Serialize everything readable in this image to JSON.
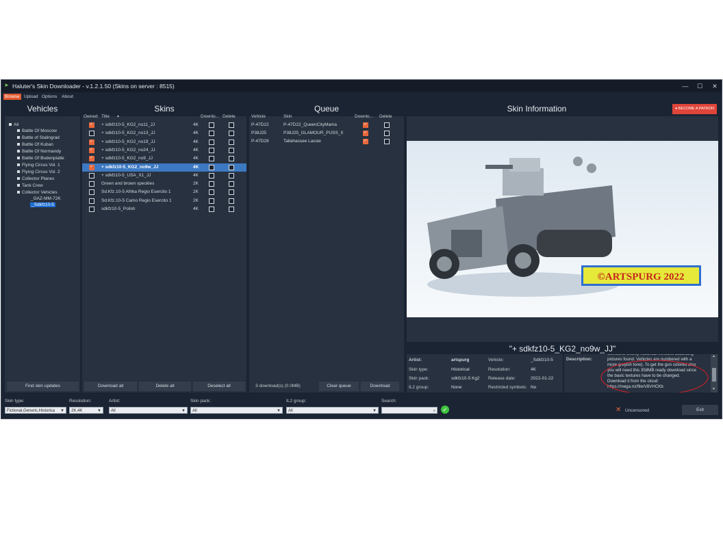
{
  "window": {
    "title": "Haluter's Skin Downloader - v.1.2.1.50 (Skins on server : 8515)",
    "controls": {
      "minimize": "—",
      "maximize": "☐",
      "close": "✕"
    }
  },
  "menu": [
    "Browse",
    "Upload",
    "Options",
    "About"
  ],
  "vehicles": {
    "title": "Vehicles",
    "root": "All",
    "groups": [
      "Battle Of Moscow",
      "Battle of Stalingrad",
      "Battle Of Kuban",
      "Battle Of Normandy",
      "Battle Of Bodenplatte",
      "Flying Circus Vol. 1",
      "Flying Circus Vol. 2",
      "Collector Planes",
      "Tank Crew",
      "Collector Vehicles"
    ],
    "children": [
      "_GAZ-MM-72K",
      "_Sdkfz10-5"
    ],
    "find_button": "Find skin updates"
  },
  "skins": {
    "title": "Skins",
    "columns": {
      "owned": "Owned",
      "title": "Title",
      "res": "Downlo...",
      "delete": "Delete"
    },
    "rows": [
      {
        "title": "+ sdkfz10-5_KG2_no11_JJ",
        "res": "4K",
        "owned": true,
        "download": false,
        "del": false,
        "sel": false
      },
      {
        "title": "+ sdkfz10-5_KG2_no13_JJ",
        "res": "4K",
        "owned": false,
        "download": false,
        "del": false,
        "sel": false
      },
      {
        "title": "+ sdkfz10-5_KG2_no19_JJ",
        "res": "4K",
        "owned": true,
        "download": false,
        "del": false,
        "sel": false
      },
      {
        "title": "+ sdkfz10-5_KG2_no24_JJ",
        "res": "4K",
        "owned": true,
        "download": false,
        "del": false,
        "sel": false
      },
      {
        "title": "+ sdkfz10-5_KG2_no9_JJ",
        "res": "4K",
        "owned": true,
        "download": false,
        "del": false,
        "sel": false
      },
      {
        "title": "+ sdkfz10-5_KG2_no9w_JJ",
        "res": "4K",
        "owned": true,
        "download": false,
        "del": false,
        "sel": true
      },
      {
        "title": "+ sdkfz10-5_USA_X1_JJ",
        "res": "4K",
        "owned": false,
        "download": false,
        "del": false,
        "sel": false
      },
      {
        "title": "Green and brown speckles",
        "res": "2K",
        "owned": false,
        "download": false,
        "del": false,
        "sel": false
      },
      {
        "title": "Sd.Kfz.10-5 Afrika Regio Esercito 1",
        "res": "2K",
        "owned": false,
        "download": false,
        "del": false,
        "sel": false
      },
      {
        "title": "Sd.Kfz.10-5 Camo Regio Esercito 1",
        "res": "2K",
        "owned": false,
        "download": false,
        "del": false,
        "sel": false
      },
      {
        "title": "sdkfz10-5_Polish",
        "res": "4K",
        "owned": false,
        "download": false,
        "del": false,
        "sel": false
      }
    ],
    "buttons": {
      "download_all": "Download all",
      "delete_all": "Delete all",
      "deselect_all": "Deselect all"
    }
  },
  "queue": {
    "title": "Queue",
    "columns": {
      "vehicle": "Vehicle",
      "skin": "Skin",
      "dl": "Downlo...",
      "delete": "Delete"
    },
    "rows": [
      {
        "vehicle": "P-47D22",
        "skin": "P-47D22_QueenCityMama",
        "dl": true,
        "del": false
      },
      {
        "vehicle": "P38J25",
        "skin": "P38J25_GLAMOUR_PUSS_II",
        "dl": true,
        "del": false
      },
      {
        "vehicle": "P-47D28",
        "skin": "Tallahassee Lassie",
        "dl": true,
        "del": false
      }
    ],
    "status": "3 download(s) (0.0MB)",
    "buttons": {
      "clear": "Clear queue",
      "download": "Download"
    }
  },
  "info": {
    "title": "Skin Information",
    "patron_button": "BECOME A PATRON",
    "watermark": "©ARTSPURG 2022",
    "skin_name": "\"+ sdkfz10-5_KG2_no9w_JJ\"",
    "details": {
      "artist_label": "Artist:",
      "artist": "artspurg",
      "type_label": "Skin type:",
      "type": "Historical",
      "pack_label": "Skin pack:",
      "pack": "sdkfz10-5 Kg2",
      "group_label": "IL2 group:",
      "group": "None",
      "vehicle_label": "Vehicle:",
      "vehicle": "_Sdkfz10-5",
      "res_label": "Resolution:",
      "res": "4K",
      "date_label": "Release date:",
      "date": "2022-01-22",
      "restricted_label": "Restricted symbols:",
      "restricted": "No"
    },
    "description_label": "Description:",
    "description_lines": [
      "Someone shortly historical versions according",
      "pictures found. Vehicles are numbered with a",
      "more greyish tone). To get the gun colored also",
      "you will need this 358MB ready download since",
      "the basic textures have to be changed.",
      "Download it from the cloud:",
      "https://mega.nz/file/V8VHCKb"
    ]
  },
  "filters": {
    "skin_type_label": "Skin type:",
    "skin_type": "Fictional,Generic,Historica",
    "resolution_label": "Resolution:",
    "resolution": "2K,4K",
    "artist_label": "Artist:",
    "artist": "All",
    "pack_label": "Skin pack:",
    "pack": "All",
    "group_label": "IL2 group:",
    "group": "All",
    "search_label": "Search:",
    "search": ""
  },
  "footer": {
    "uncensored": "Uncensored",
    "exit": "Exit"
  },
  "colors": {
    "accent": "#e8683c",
    "selection": "#3d79c2",
    "bg": "#1b2433",
    "panel": "#27313f"
  }
}
